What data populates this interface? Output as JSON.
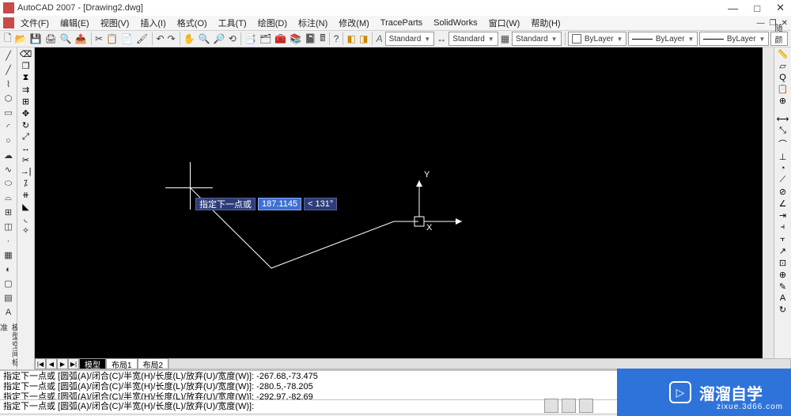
{
  "app": {
    "title": "AutoCAD 2007 - [Drawing2.dwg]"
  },
  "menu": {
    "items": [
      "文件(F)",
      "编辑(E)",
      "视图(V)",
      "插入(I)",
      "格式(O)",
      "工具(T)",
      "绘图(D)",
      "标注(N)",
      "修改(M)",
      "TraceParts",
      "SolidWorks",
      "窗口(W)",
      "帮助(H)"
    ]
  },
  "styles": {
    "textStyle": "Standard",
    "dimStyle": "Standard",
    "tableStyle": "Standard",
    "layer": "ByLayer",
    "color": "ByLayer",
    "linetype": "ByLayer",
    "plotColor": "随颜色"
  },
  "ucs": {
    "x": "X",
    "y": "Y"
  },
  "dynamic": {
    "prompt": "指定下一点或",
    "distance": "187.1145",
    "angle": "< 131°"
  },
  "tabs": {
    "model": "模型",
    "layout1": "布局1",
    "layout2": "布局2"
  },
  "cmd": {
    "lines": [
      "指定下一点或 [圆弧(A)/闭合(C)/半宽(H)/长度(L)/放弃(U)/宽度(W)]: -267.68,-73.475",
      "指定下一点或 [圆弧(A)/闭合(C)/半宽(H)/长度(L)/放弃(U)/宽度(W)]: -280.5,-78.205",
      "指定下一点或 [圆弧(A)/闭合(C)/半宽(H)/长度(L)/放弃(U)/宽度(W)]: -292.97,-82.69"
    ],
    "input": "指定下一点或 [圆弧(A)/闭合(C)/半宽(H)/长度(L)/放弃(U)/宽度(W)]:"
  },
  "watermark": {
    "brand": "溜溜自学",
    "url": "zixue.3d66.com"
  },
  "vlabel": "模型空间标准"
}
